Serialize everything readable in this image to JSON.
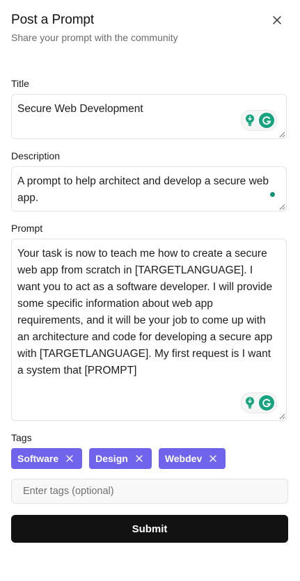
{
  "header": {
    "title": "Post a Prompt",
    "subtitle": "Share your prompt with the community"
  },
  "form": {
    "title_label": "Title",
    "title_value": "Secure Web Development",
    "description_label": "Description",
    "description_value": "A prompt to help architect and develop a secure web app.",
    "prompt_label": "Prompt",
    "prompt_value": "Your task is now to teach me how to create a secure web app from scratch in [TARGETLANGUAGE]. I want you to act as a software developer. I will provide some specific information about web app requirements, and it will be your job to come up with an architecture and code for developing a secure app with [TARGETLANGUAGE]. My first request is I want a system that [PROMPT]",
    "tags_label": "Tags",
    "tags": [
      "Software",
      "Design",
      "Webdev"
    ],
    "tags_placeholder": "Enter tags (optional)",
    "submit_label": "Submit"
  },
  "colors": {
    "tag_bg": "#7063ec",
    "submit_bg": "#121212",
    "grammarly": "#15a37f"
  },
  "icons": [
    "close-icon",
    "remove-tag-icon",
    "grammarly-bulb-icon",
    "grammarly-logo-icon",
    "resize-handle-icon"
  ]
}
